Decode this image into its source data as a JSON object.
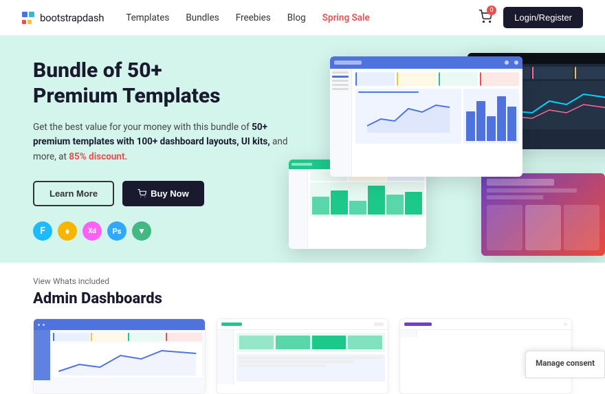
{
  "nav": {
    "logo_text_bold": "bootstrap",
    "logo_text_light": "dash",
    "links": [
      {
        "label": "Templates",
        "id": "templates"
      },
      {
        "label": "Bundles",
        "id": "bundles"
      },
      {
        "label": "Freebies",
        "id": "freebies"
      },
      {
        "label": "Blog",
        "id": "blog"
      },
      {
        "label": "Spring Sale",
        "id": "spring-sale"
      }
    ],
    "cart_count": "0",
    "login_label": "Login/Register"
  },
  "hero": {
    "title_line1": "Bundle of 50+",
    "title_line2": "Premium Templates",
    "desc_prefix": "Get the best value for your money with this bundle of ",
    "desc_bold": "50+ premium templates with 100+ dashboard layouts, UI kits,",
    "desc_suffix": " and more, at ",
    "desc_discount": "85% discount.",
    "btn_learn": "Learn More",
    "btn_buy": "Buy Now",
    "tools": [
      {
        "symbol": "F",
        "class": "ti-figma",
        "title": "Figma"
      },
      {
        "symbol": "♦",
        "class": "ti-sketch",
        "title": "Sketch"
      },
      {
        "symbol": "Xd",
        "class": "ti-xd",
        "title": "Adobe XD"
      },
      {
        "symbol": "Ps",
        "class": "ti-ps",
        "title": "Photoshop"
      },
      {
        "symbol": "V",
        "class": "ti-vue",
        "title": "Vue"
      }
    ]
  },
  "lower": {
    "section_label": "View Whats included",
    "section_title": "Admin Dashboards",
    "cards": [
      {
        "id": "card1",
        "color1": "#4e73df",
        "color2": "#36b9cc"
      },
      {
        "id": "card2",
        "color1": "#1cc88a",
        "color2": "#36b9cc"
      },
      {
        "id": "card3",
        "color1": "#6f42c1",
        "color2": "#e74a3b"
      }
    ]
  },
  "cookie": {
    "title": "Manage consent"
  },
  "colors": {
    "accent": "#4e73df",
    "red": "#e94f4f",
    "dark": "#1a1a2e",
    "hero_bg": "#d4f5ec"
  }
}
